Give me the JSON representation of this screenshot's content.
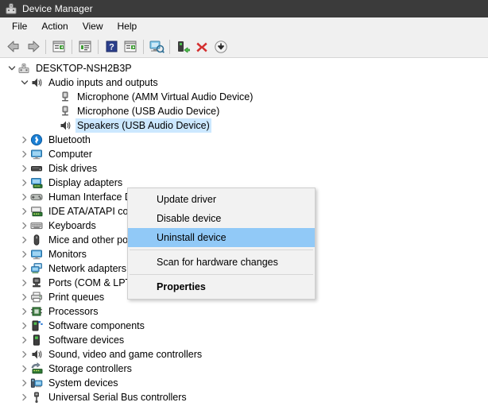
{
  "window": {
    "title": "Device Manager",
    "title_icon": "device-manager-icon"
  },
  "menubar": {
    "items": [
      {
        "label": "File",
        "name": "menu-file"
      },
      {
        "label": "Action",
        "name": "menu-action"
      },
      {
        "label": "View",
        "name": "menu-view"
      },
      {
        "label": "Help",
        "name": "menu-help"
      }
    ]
  },
  "toolbar": {
    "buttons": [
      {
        "icon": "back-arrow-icon",
        "tooltip": "Back"
      },
      {
        "icon": "forward-arrow-icon",
        "tooltip": "Forward"
      },
      {
        "sep": true
      },
      {
        "icon": "show-hide-console-tree-icon",
        "tooltip": "Show/Hide Console Tree"
      },
      {
        "sep": true
      },
      {
        "icon": "properties-icon",
        "tooltip": "Properties"
      },
      {
        "sep": true
      },
      {
        "icon": "help-icon",
        "tooltip": "Help"
      },
      {
        "icon": "show-hide-action-pane-icon",
        "tooltip": "Show/Hide Action Pane"
      },
      {
        "sep": true
      },
      {
        "icon": "scan-for-hardware-changes-icon",
        "tooltip": "Scan for hardware changes"
      },
      {
        "sep": true
      },
      {
        "icon": "update-driver-icon",
        "tooltip": "Update driver"
      },
      {
        "icon": "uninstall-device-icon",
        "tooltip": "Uninstall device"
      },
      {
        "icon": "disable-device-icon",
        "tooltip": "Disable device"
      }
    ]
  },
  "tree": {
    "nodes": [
      {
        "label": "DESKTOP-NSH2B3P",
        "level": 0,
        "expanded": true,
        "icon": "computer-root-icon",
        "selected": false
      },
      {
        "label": "Audio inputs and outputs",
        "level": 1,
        "expanded": true,
        "icon": "speaker-icon",
        "selected": false
      },
      {
        "label": "Microphone (AMM Virtual Audio Device)",
        "level": 2,
        "expanded": null,
        "icon": "microphone-icon",
        "selected": false
      },
      {
        "label": "Microphone (USB Audio Device)",
        "level": 2,
        "expanded": null,
        "icon": "microphone-icon",
        "selected": false
      },
      {
        "label": "Speakers (USB Audio Device)",
        "level": 2,
        "expanded": null,
        "icon": "speaker-icon",
        "selected": true
      },
      {
        "label": "Bluetooth",
        "level": 1,
        "expanded": false,
        "icon": "bluetooth-icon",
        "selected": false
      },
      {
        "label": "Computer",
        "level": 1,
        "expanded": false,
        "icon": "monitor-icon",
        "selected": false
      },
      {
        "label": "Disk drives",
        "level": 1,
        "expanded": false,
        "icon": "disk-drive-icon",
        "selected": false
      },
      {
        "label": "Display adapters",
        "level": 1,
        "expanded": false,
        "icon": "display-adapter-icon",
        "selected": false
      },
      {
        "label": "Human Interface D",
        "level": 1,
        "expanded": false,
        "icon": "hid-icon",
        "selected": false
      },
      {
        "label": "IDE ATA/ATAPI con",
        "level": 1,
        "expanded": false,
        "icon": "ide-controller-icon",
        "selected": false
      },
      {
        "label": "Keyboards",
        "level": 1,
        "expanded": false,
        "icon": "keyboard-icon",
        "selected": false
      },
      {
        "label": "Mice and other pointing devices",
        "level": 1,
        "expanded": false,
        "icon": "mouse-icon",
        "selected": false
      },
      {
        "label": "Monitors",
        "level": 1,
        "expanded": false,
        "icon": "monitor-icon",
        "selected": false
      },
      {
        "label": "Network adapters",
        "level": 1,
        "expanded": false,
        "icon": "network-adapter-icon",
        "selected": false
      },
      {
        "label": "Ports (COM & LPT)",
        "level": 1,
        "expanded": false,
        "icon": "port-icon",
        "selected": false
      },
      {
        "label": "Print queues",
        "level": 1,
        "expanded": false,
        "icon": "printer-icon",
        "selected": false
      },
      {
        "label": "Processors",
        "level": 1,
        "expanded": false,
        "icon": "processor-icon",
        "selected": false
      },
      {
        "label": "Software components",
        "level": 1,
        "expanded": false,
        "icon": "software-component-icon",
        "selected": false
      },
      {
        "label": "Software devices",
        "level": 1,
        "expanded": false,
        "icon": "software-device-icon",
        "selected": false
      },
      {
        "label": "Sound, video and game controllers",
        "level": 1,
        "expanded": false,
        "icon": "speaker-icon",
        "selected": false
      },
      {
        "label": "Storage controllers",
        "level": 1,
        "expanded": false,
        "icon": "storage-controller-icon",
        "selected": false
      },
      {
        "label": "System devices",
        "level": 1,
        "expanded": false,
        "icon": "system-device-icon",
        "selected": false
      },
      {
        "label": "Universal Serial Bus controllers",
        "level": 1,
        "expanded": false,
        "icon": "usb-icon",
        "selected": false
      }
    ]
  },
  "context_menu": {
    "items": [
      {
        "label": "Update driver",
        "highlight": false,
        "bold": false,
        "sep_after": false
      },
      {
        "label": "Disable device",
        "highlight": false,
        "bold": false,
        "sep_after": false
      },
      {
        "label": "Uninstall device",
        "highlight": true,
        "bold": false,
        "sep_after": true
      },
      {
        "label": "Scan for hardware changes",
        "highlight": false,
        "bold": false,
        "sep_after": true
      },
      {
        "label": "Properties",
        "highlight": false,
        "bold": true,
        "sep_after": false
      }
    ]
  },
  "colors": {
    "titlebar_bg": "#3b3b3b",
    "chrome_bg": "#f0f0f0",
    "selection_blue": "#cce8ff",
    "menu_highlight_blue": "#91c9f7",
    "menu_bg": "#f2f2f2"
  }
}
